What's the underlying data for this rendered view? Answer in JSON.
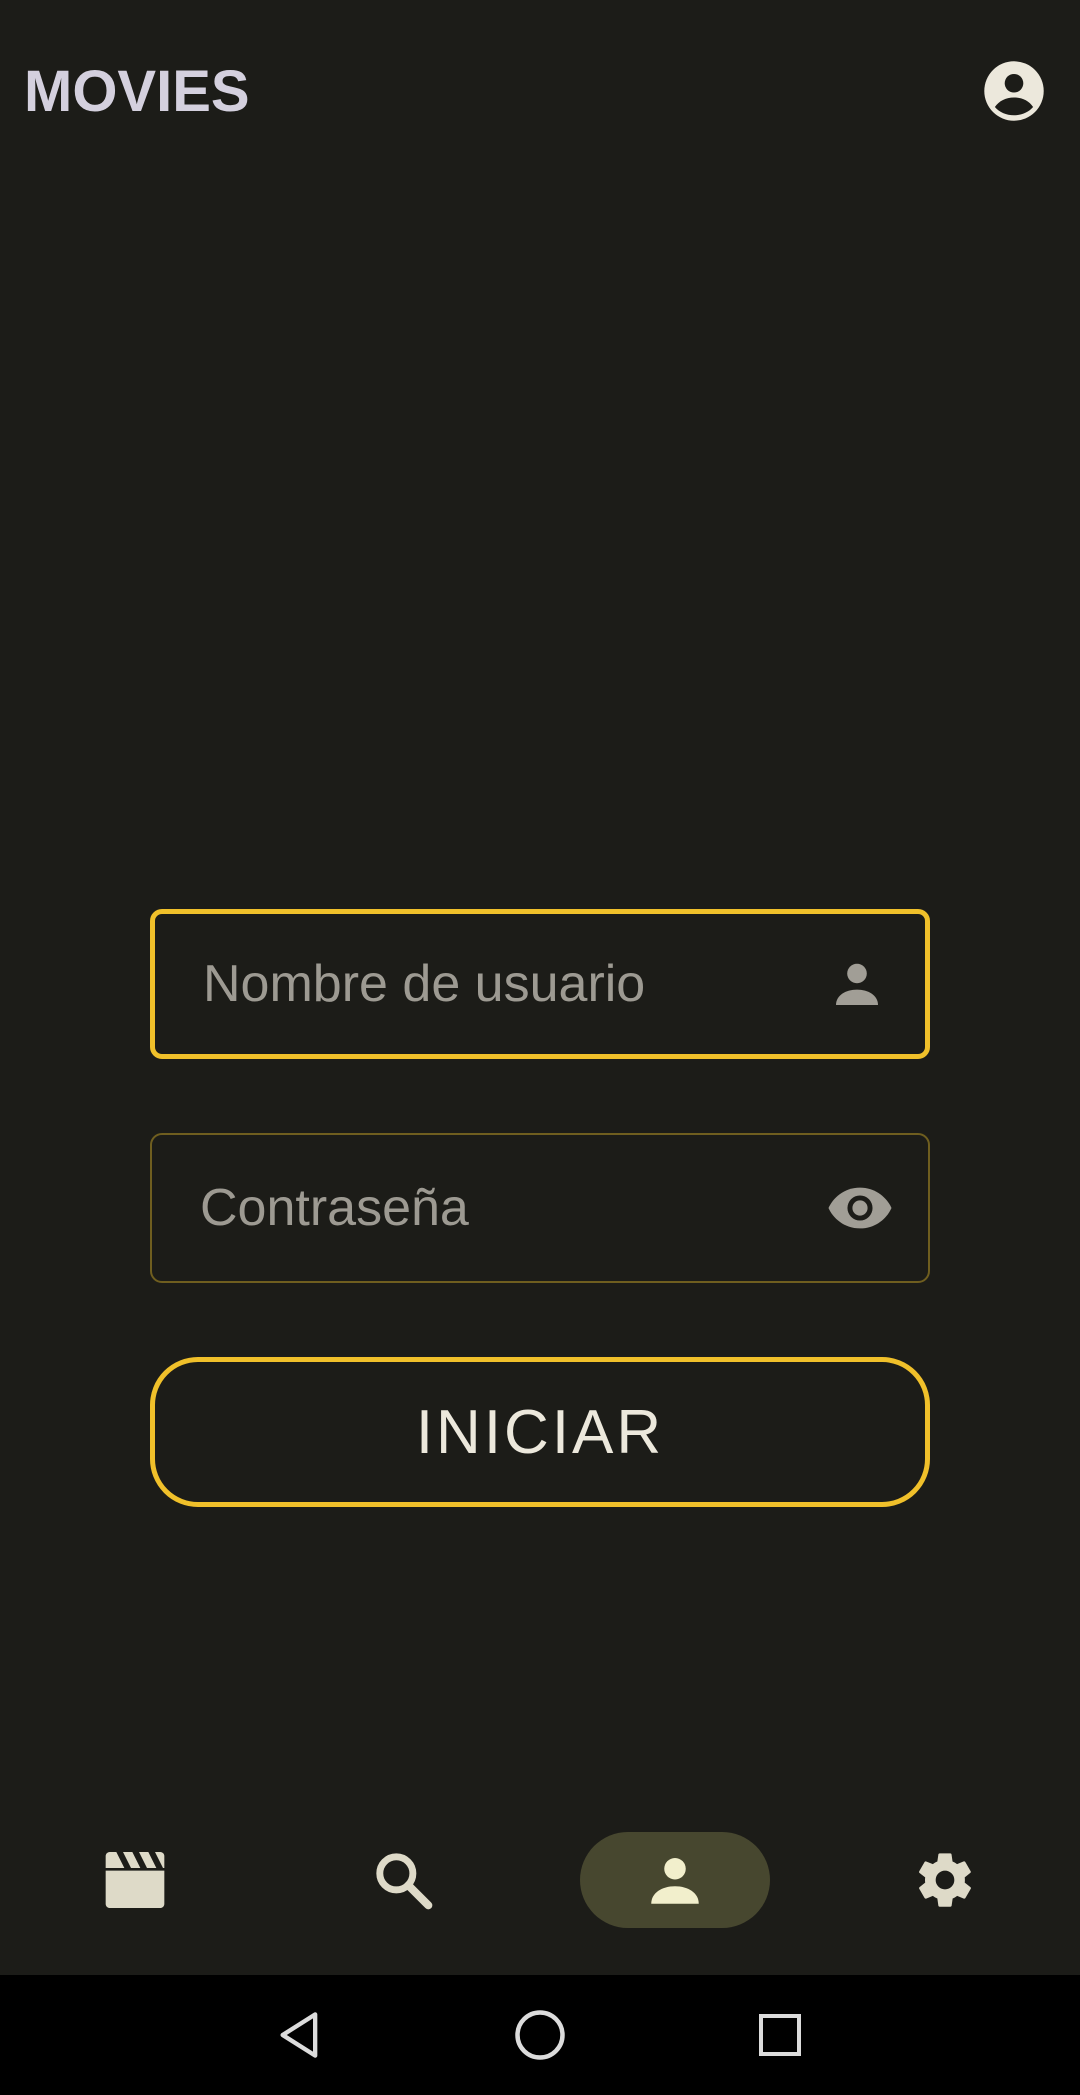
{
  "app": {
    "title": "MOVIES"
  },
  "login": {
    "username_placeholder": "Nombre de usuario",
    "password_placeholder": "Contraseña",
    "submit_label": "INICIAR"
  },
  "nav": {
    "items": [
      {
        "icon": "movie-clapper-icon",
        "active": false
      },
      {
        "icon": "search-icon",
        "active": false
      },
      {
        "icon": "person-icon",
        "active": true
      },
      {
        "icon": "gear-icon",
        "active": false
      }
    ]
  },
  "system_nav": [
    "back-icon",
    "home-icon",
    "recents-icon"
  ],
  "colors": {
    "background": "#1c1c18",
    "accent": "#f0c02a",
    "active_nav_pill": "#47472f",
    "title": "#d4d0de"
  }
}
